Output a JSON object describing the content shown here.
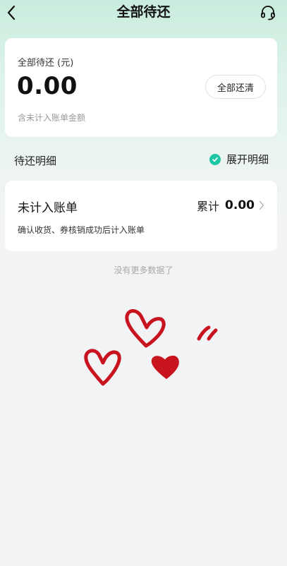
{
  "header": {
    "title": "全部待还",
    "back_icon": "chevron-left-icon",
    "support_icon": "headset-icon"
  },
  "summary": {
    "label": "全部待还 (元)",
    "amount": "0.00",
    "pay_all_button": "全部还清",
    "note": "含未计入账单金额"
  },
  "details": {
    "section_title": "待还明细",
    "expand_label": "展开明细",
    "expand_checked": true,
    "accent_color": "#1ec6a5"
  },
  "bill": {
    "title": "未计入账单",
    "total_label": "累计",
    "total_value": "0.00",
    "description": "确认收货、券核销成功后计入账单"
  },
  "footer": {
    "no_more_text": "没有更多数据了"
  },
  "doodle": {
    "icon": "hearts-doodle",
    "color": "#c8141e"
  }
}
